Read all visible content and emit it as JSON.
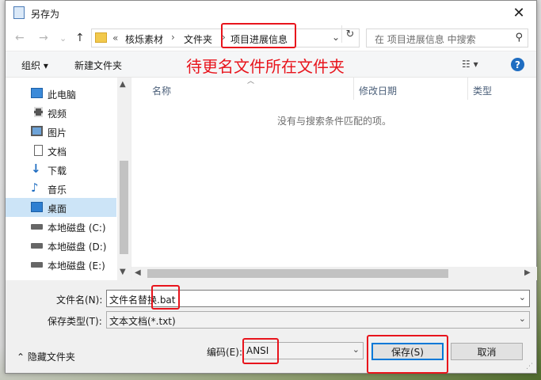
{
  "window": {
    "title": "另存为",
    "close": "✕"
  },
  "nav": {
    "back": "←",
    "forward": "→",
    "dropdown": "⌄",
    "up": "↑",
    "address": {
      "overflow": "«",
      "crumbs": [
        "核烁素材",
        "文件夹",
        "项目进展信息"
      ],
      "separators": [
        "›",
        "›"
      ]
    },
    "refresh": "↻",
    "search": {
      "placeholder": "在 项目进展信息 中搜索",
      "icon": "⚲"
    }
  },
  "toolbar": {
    "organize": "组织 ▾",
    "new_folder": "新建文件夹",
    "annotation": "待更名文件所在文件夹",
    "view": "☷ ▾",
    "help": "?"
  },
  "sidebar": {
    "items": [
      {
        "label": "此电脑",
        "icon": "computer-icon"
      },
      {
        "label": "视频",
        "icon": "video-icon"
      },
      {
        "label": "图片",
        "icon": "picture-icon"
      },
      {
        "label": "文档",
        "icon": "document-icon"
      },
      {
        "label": "下载",
        "icon": "download-icon"
      },
      {
        "label": "音乐",
        "icon": "music-icon"
      },
      {
        "label": "桌面",
        "icon": "desktop-icon",
        "selected": true
      },
      {
        "label": "本地磁盘 (C:)",
        "icon": "drive-icon"
      },
      {
        "label": "本地磁盘 (D:)",
        "icon": "drive-icon"
      },
      {
        "label": "本地磁盘 (E:)",
        "icon": "drive-icon"
      }
    ]
  },
  "file_list": {
    "columns": [
      "名称",
      "修改日期",
      "类型"
    ],
    "empty_message": "没有与搜索条件匹配的项。"
  },
  "form": {
    "filename_label": "文件名(N):",
    "filename_value": "文件名替换.bat",
    "filetype_label": "保存类型(T):",
    "filetype_value": "文本文档(*.txt)",
    "hide_folders": "隐藏文件夹",
    "encoding_label": "编码(E):",
    "encoding_value": "ANSI",
    "save_button": "保存(S)",
    "cancel_button": "取消"
  },
  "colors": {
    "annotation": "#e8141c",
    "selection": "#cce4f7",
    "accent": "#0078d7"
  }
}
